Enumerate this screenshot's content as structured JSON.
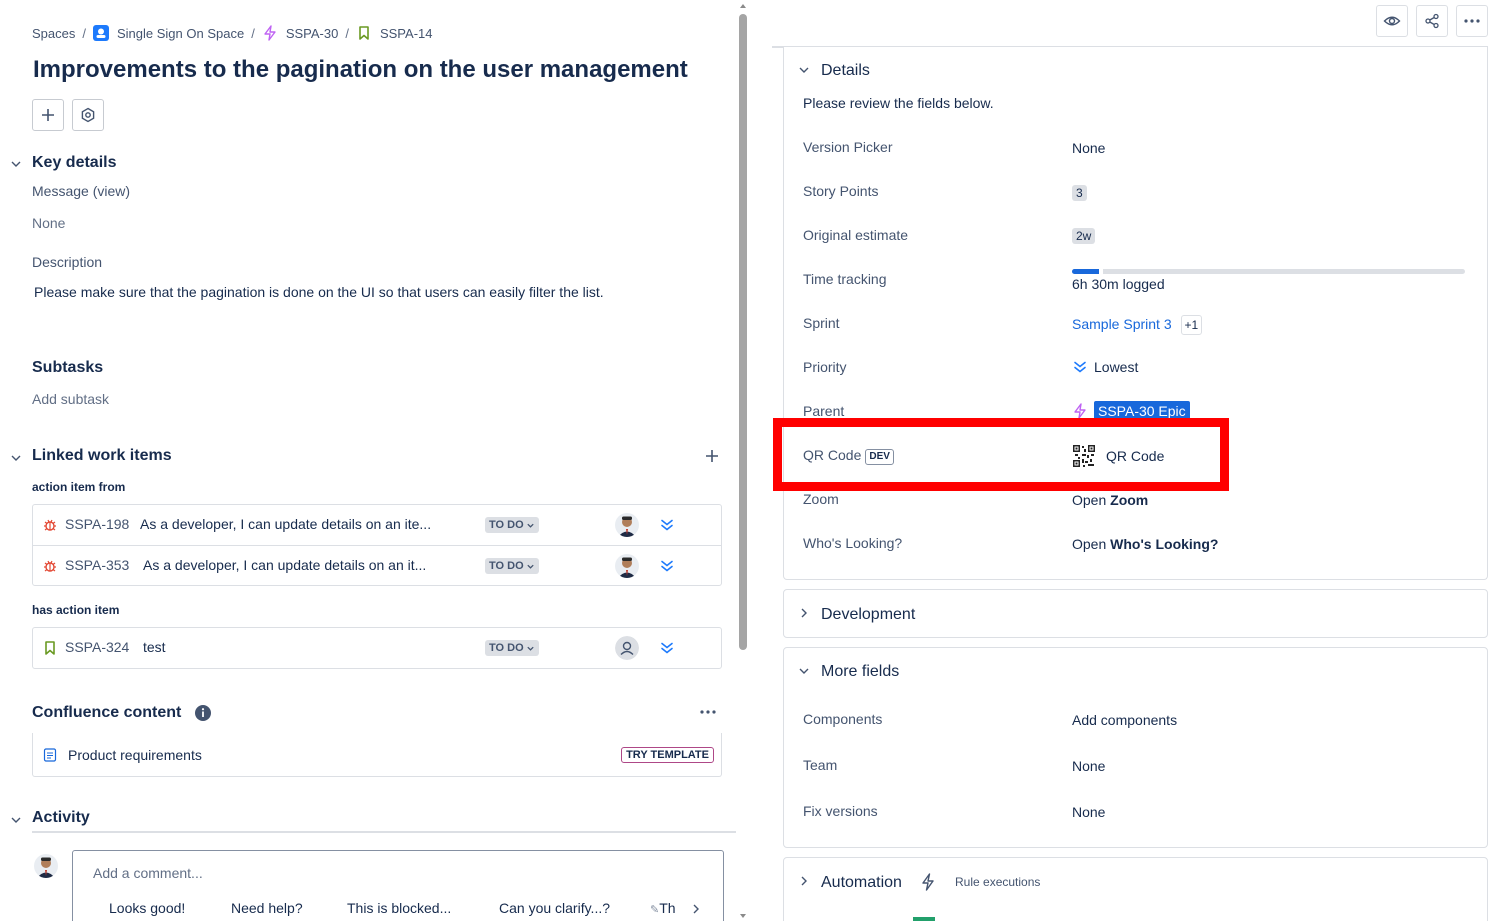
{
  "breadcrumbs": {
    "spaces": "Spaces",
    "space": "Single Sign On Space",
    "epic": "SSPA-30",
    "issue": "SSPA-14"
  },
  "title": "Improvements to the pagination on the user management",
  "key_details": {
    "heading": "Key details",
    "message_label": "Message (view)",
    "message_value": "None",
    "description_label": "Description",
    "description_value": "Please make sure that the pagination is done on the UI so that users can easily filter the list."
  },
  "subtasks": {
    "heading": "Subtasks",
    "add": "Add subtask"
  },
  "linked": {
    "heading": "Linked work items",
    "groups": [
      {
        "label": "action item from",
        "items": [
          {
            "key": "SSPA-198",
            "summary": "As a developer, I can update details on an ite...",
            "status": "TO DO"
          },
          {
            "key": "SSPA-353",
            "summary": "As a developer, I can update details on an it...",
            "status": "TO DO"
          }
        ]
      },
      {
        "label": "has action item",
        "items": [
          {
            "key": "SSPA-324",
            "summary": "test",
            "status": "TO DO"
          }
        ]
      }
    ]
  },
  "confluence": {
    "heading": "Confluence content",
    "item": "Product requirements",
    "badge": "TRY TEMPLATE"
  },
  "activity": {
    "heading": "Activity",
    "placeholder": "Add a comment...",
    "chips": [
      "Looks good!",
      "Need help?",
      "This is blocked...",
      "Can you clarify...?",
      "Th"
    ]
  },
  "details": {
    "heading": "Details",
    "intro": "Please review the fields below.",
    "fields": {
      "version_picker": {
        "label": "Version Picker",
        "value": "None"
      },
      "story_points": {
        "label": "Story Points",
        "value": "3"
      },
      "original_estimate": {
        "label": "Original estimate",
        "value": "2w"
      },
      "time_tracking": {
        "label": "Time tracking",
        "value": "6h 30m logged",
        "progress": 0.08
      },
      "sprint": {
        "label": "Sprint",
        "value": "Sample Sprint 3",
        "extra": "+1"
      },
      "priority": {
        "label": "Priority",
        "value": "Lowest"
      },
      "parent": {
        "label": "Parent",
        "value": "SSPA-30 Epic"
      },
      "qr_code": {
        "label": "QR Code",
        "tag": "DEV",
        "value": "QR Code"
      },
      "zoom": {
        "label": "Zoom",
        "prefix": "Open",
        "value": "Zoom"
      },
      "whos_looking": {
        "label": "Who's Looking?",
        "prefix": "Open",
        "value": "Who's Looking?"
      }
    }
  },
  "development": {
    "heading": "Development"
  },
  "more_fields": {
    "heading": "More fields",
    "components": {
      "label": "Components",
      "value": "Add components"
    },
    "team": {
      "label": "Team",
      "value": "None"
    },
    "fix_versions": {
      "label": "Fix versions",
      "value": "None"
    }
  },
  "automation": {
    "heading": "Automation",
    "sub": "Rule executions"
  },
  "colors": {
    "accent": "#1868db",
    "highlight": "#ff0000",
    "bug": "#e34935",
    "story": "#6a9a23",
    "epic": "#bf63f3"
  },
  "icons": [
    "spaces-icon",
    "lightning-icon",
    "bookmark-icon",
    "bug-icon",
    "chevron-down-icon",
    "plus-icon",
    "settings-icon",
    "eye-icon",
    "share-icon",
    "more-icon",
    "priority-lowest-icon",
    "qr-icon",
    "info-icon",
    "page-icon"
  ]
}
